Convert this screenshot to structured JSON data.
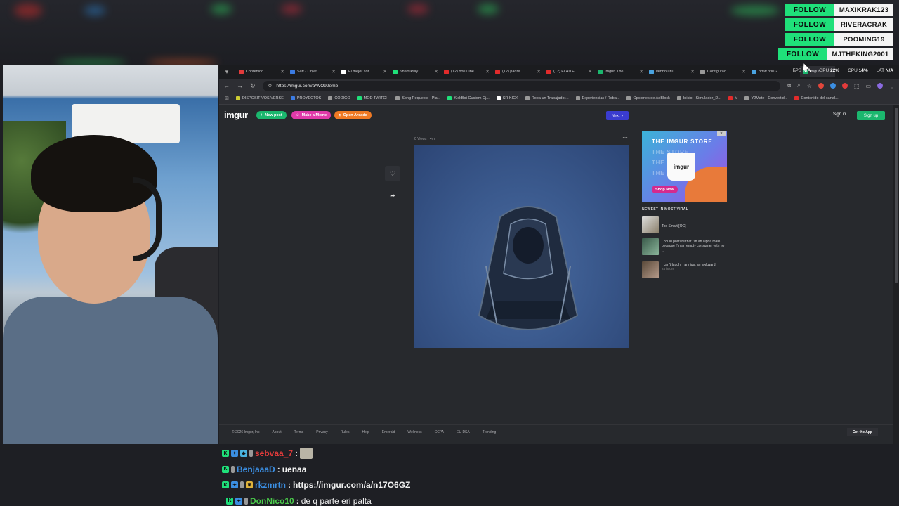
{
  "follow_alerts": [
    {
      "action": "FOLLOW",
      "name": "MAXIKRAK123"
    },
    {
      "action": "FOLLOW",
      "name": "RIVERACRAK"
    },
    {
      "action": "FOLLOW",
      "name": "POOMING19"
    },
    {
      "action": "FOLLOW",
      "name": "MJTHEKING2001"
    }
  ],
  "browser": {
    "tabs": [
      {
        "title": "Contenido",
        "color": "#e23b3b"
      },
      {
        "title": "Satt - Objeti",
        "color": "#3b7be2"
      },
      {
        "title": "El mejor sof",
        "color": "#ffffff"
      },
      {
        "title": "ShamiPlay",
        "color": "#1fe07a"
      },
      {
        "title": "(12) YouTube",
        "color": "#e22b2b"
      },
      {
        "title": "(12) padre",
        "color": "#e22b2b"
      },
      {
        "title": "(12) FLAITE",
        "color": "#e22b2b"
      },
      {
        "title": "Imgur: The",
        "color": "#1bb76e"
      },
      {
        "title": "lambo uru",
        "color": "#4aa3e0"
      },
      {
        "title": "Configurac",
        "color": "#999999"
      },
      {
        "title": "bmw 330 2",
        "color": "#4aa3e0"
      },
      {
        "title": "Imgur",
        "color": "#1bb76e"
      }
    ],
    "system": {
      "fps_label": "FPS",
      "fps_value": "N/A",
      "gpu_label": "GPU",
      "gpu_value": "22%",
      "cpu_label": "CPU",
      "cpu_value": "14%",
      "lat_label": "LAT",
      "lat_value": "N/A"
    },
    "url": "https://imgur.com/a/WO99emb",
    "bookmarks": [
      {
        "label": "DISPOSITIVOS VERSE",
        "color": "#cccc33"
      },
      {
        "label": "PROYECTOS",
        "color": "#3b7be2"
      },
      {
        "label": "CODIGO",
        "color": "#999999"
      },
      {
        "label": "MOD TWITCH",
        "color": "#1fe07a"
      },
      {
        "label": "Song Requests - Pla...",
        "color": "#999999"
      },
      {
        "label": "KickBot Custom Cj...",
        "color": "#1fe07a"
      },
      {
        "label": "SR KICK",
        "color": "#ffffff"
      },
      {
        "label": "Roba un Trabajador...",
        "color": "#999999"
      },
      {
        "label": "Experiencias / Roba...",
        "color": "#999999"
      },
      {
        "label": "Opciones de AdBlock",
        "color": "#999999"
      },
      {
        "label": "Inicio - Simulador_D...",
        "color": "#999999"
      },
      {
        "label": "M",
        "color": "#e22b2b"
      },
      {
        "label": "Y2Mate - Convertid...",
        "color": "#999999"
      },
      {
        "label": "Contenido del canal...",
        "color": "#e22b2b"
      }
    ]
  },
  "imgur": {
    "logo": "imgur",
    "new_post": "New post",
    "make_meme": "Make a Meme",
    "open_arcade": "Open Arcade",
    "next": "Next",
    "sign_in": "Sign in",
    "sign_up": "Sign up",
    "post_meta": "0 Views · 4m",
    "ad": {
      "title": "THE IMGUR STORE",
      "ghost1": "THE STORE",
      "ghost2": "THE STORE",
      "ghost3": "THE STORE",
      "mug_logo": "imgur",
      "shop_now": "Shop Now"
    },
    "viral_heading": "NEWEST IN MOST VIRAL",
    "viral_items": [
      {
        "title": "Too Smart [OC]",
        "sub": ""
      },
      {
        "title": "I could posture that I'm an alpha male because I'm an empty consumer with no ...",
        "sub": ""
      },
      {
        "title": "I can't laugh, I am just an awkward",
        "sub": "24 hours"
      }
    ],
    "footer": [
      "© 2026 Imgur, Inc",
      "About",
      "Terms",
      "Privacy",
      "Rules",
      "Help",
      "Emerald",
      "Wellness",
      "CCPA",
      "EU DSA",
      "Trending"
    ],
    "get_app": "Get the App"
  },
  "chat": [
    {
      "user": "sebvaa_7",
      "user_color": "#e23b3b",
      "message": ""
    },
    {
      "user": "BenjaaaD",
      "user_color": "#3b8ee2",
      "message": "uenaa"
    },
    {
      "user": "rkzmrtn",
      "user_color": "#3b8ee2",
      "message": "https://imgur.com/a/n17O6GZ"
    },
    {
      "user": "DonNico10",
      "user_color": "#4ac94a",
      "message": "de q parte eri palta"
    }
  ]
}
